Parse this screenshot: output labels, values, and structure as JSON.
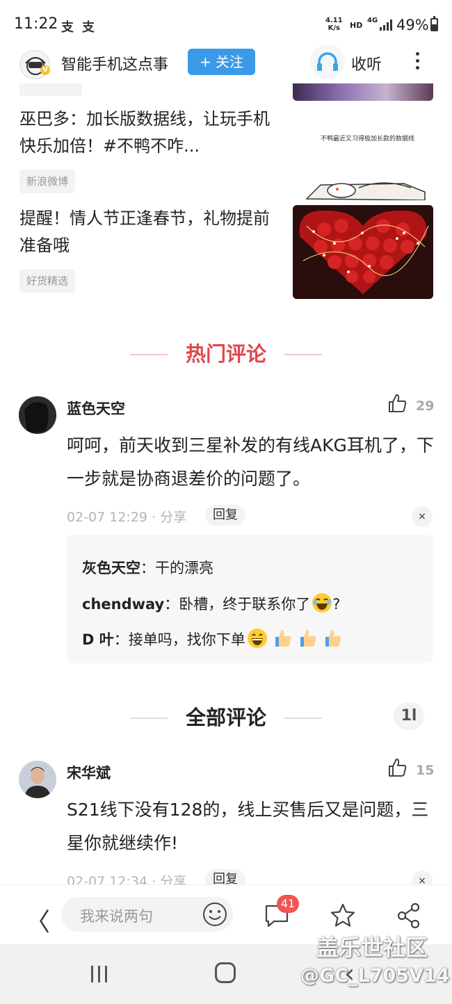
{
  "status_bar": {
    "time": "11:22",
    "app_icons": [
      "支",
      "支"
    ],
    "speed_value": "4.11",
    "speed_unit": "K/s",
    "hd": "HD",
    "network": "4G",
    "battery": "49%"
  },
  "header": {
    "account_name": "智能手机这点事",
    "follow_label": "+ 关注",
    "listen_label": "收听"
  },
  "recommendations": [
    {
      "title": "巫巴多：加长版数据线，让玩手机快乐加倍！#不鸭不咋...",
      "tag": "新浪微博",
      "thumb_caption": "不鸭最近又习得极加长款的数据线"
    },
    {
      "title": "提醒！情人节正逢春节，礼物提前准备哦",
      "tag": "好货精选"
    }
  ],
  "hot_comments": {
    "heading": "热门评论",
    "items": [
      {
        "user": "蓝色天空",
        "likes": "29",
        "text": "呵呵，前天收到三星补发的有线AKG耳机了，下一步就是协商退差价的问题了。",
        "meta": "02-07 12:29 · 分享",
        "reply_label": "回复",
        "close": "×",
        "replies": [
          {
            "user": "灰色天空",
            "text": "干的漂亮"
          },
          {
            "user": "chendway",
            "text": "卧槽，终于联系你了",
            "suffix": "?"
          },
          {
            "user": "D 叶",
            "text": "接单吗，找你下单"
          }
        ]
      }
    ]
  },
  "all_comments": {
    "heading": "全部评论",
    "sort_icon": "1l",
    "items": [
      {
        "user": "宋华斌",
        "likes": "15",
        "text": "S21线下没有128的，线上买售后又是问题，三星你就继续作!",
        "meta": "02-07 12:34 · 分享",
        "reply_label": "回复",
        "close": "×"
      }
    ]
  },
  "bottom_bar": {
    "back": "〈",
    "input_placeholder": "我来说两句",
    "comment_count": "41"
  },
  "watermark": {
    "line1": "盖乐世社区",
    "line2": "@GC_L705V14"
  },
  "colors": {
    "accent_blue": "#3b9ae8",
    "hot_red": "#e0474c",
    "badge_red": "#f25454"
  }
}
